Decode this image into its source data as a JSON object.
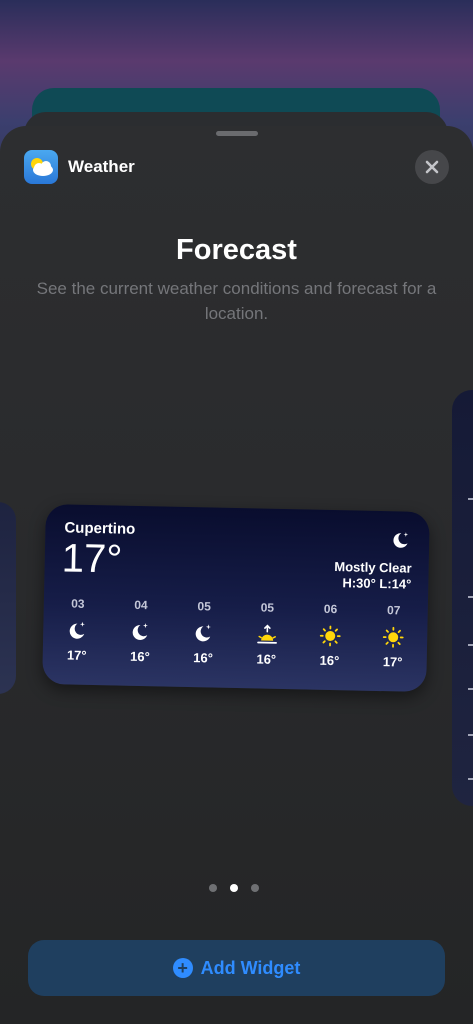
{
  "app": {
    "name": "Weather",
    "icon": "weather-app-icon"
  },
  "sheet": {
    "title": "Forecast",
    "subtitle": "See the current weather conditions and forecast for a location."
  },
  "widget": {
    "city": "Cupertino",
    "temperature": "17°",
    "condition_icon": "moon-stars-icon",
    "condition": "Mostly Clear",
    "hilo": "H:30° L:14°",
    "hours": [
      {
        "label": "03",
        "icon": "moon-stars-icon",
        "temp": "17°"
      },
      {
        "label": "04",
        "icon": "moon-stars-icon",
        "temp": "16°"
      },
      {
        "label": "05",
        "icon": "moon-stars-icon",
        "temp": "16°"
      },
      {
        "label": "05",
        "icon": "sunrise-icon",
        "temp": "16°"
      },
      {
        "label": "06",
        "icon": "sun-icon",
        "temp": "16°"
      },
      {
        "label": "07",
        "icon": "sun-icon",
        "temp": "17°"
      }
    ]
  },
  "pagination": {
    "count": 3,
    "active": 1
  },
  "add_button": {
    "label": "Add Widget",
    "icon": "plus-circle-icon"
  },
  "colors": {
    "accent": "#2f8cff",
    "sun": "#ffd60a",
    "widget_top": "#090d2e",
    "widget_bottom": "#2b3463"
  }
}
